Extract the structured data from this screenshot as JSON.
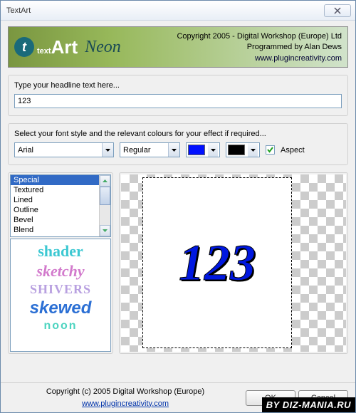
{
  "window": {
    "title": "TextArt"
  },
  "banner": {
    "logo_text": "textArt",
    "variant": "Neon",
    "copyright": "Copyright 2005 - Digital Workshop (Europe) Ltd",
    "programmer": "Programmed by Alan Dews",
    "url": "www.plugincreativity.com"
  },
  "headline": {
    "label": "Type your headline text here...",
    "value": "123"
  },
  "fontrow": {
    "label": "Select your font style and the relevant colours for your effect if required...",
    "font": "Arial",
    "weight": "Regular",
    "color1": "#0010ff",
    "color2": "#000000",
    "aspect_label": "Aspect",
    "aspect_checked": true
  },
  "styles": {
    "list": [
      "Special",
      "Textured",
      "Lined",
      "Outline",
      "Bevel",
      "Blend"
    ],
    "selected": 0,
    "previews": [
      "shader",
      "sketchy",
      "SHIVERS",
      "skewed",
      "noon"
    ]
  },
  "preview": {
    "text": "123"
  },
  "footer": {
    "copyright": "Copyright (c) 2005 Digital Workshop (Europe)",
    "url": "www.plugincreativity.com",
    "ok": "OK",
    "cancel": "Cancel"
  },
  "watermark": "BY DIZ-MANIA.RU"
}
